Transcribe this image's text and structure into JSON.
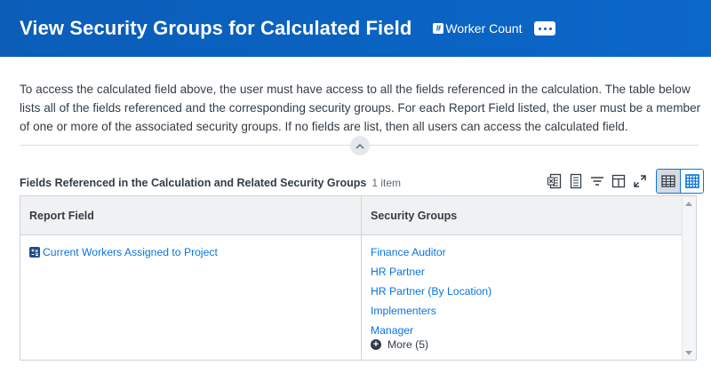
{
  "header": {
    "title": "View Security Groups for Calculated Field",
    "field_chip_icon": "#",
    "field_chip_label": "Worker Count",
    "related_actions_icon": "ellipsis-icon",
    "background_color": "#0b5db8"
  },
  "description": "To access the calculated field above, the user must have access to all the fields referenced in the calculation.  The table below lists all of the fields referenced and the corresponding security groups. For each Report Field listed, the user must be a member of one or more of the associated security groups.  If no fields are list, then all users can access the calculated field.",
  "grid": {
    "title": "Fields Referenced in the Calculation and Related Security Groups",
    "count": "1 item",
    "toolbar": [
      "export-to-excel-icon",
      "export-to-pdf-icon",
      "filter-icon",
      "column-config-icon",
      "fullscreen-icon"
    ],
    "view_toggle": [
      "table-view-icon",
      "grid-view-icon"
    ],
    "columns": [
      "Report Field",
      "Security Groups"
    ],
    "rows": [
      {
        "report_field": "Current Workers Assigned to Project",
        "security_groups": [
          "Finance Auditor",
          "HR Partner",
          "HR Partner (By Location)",
          "Implementers",
          "Manager"
        ],
        "more_label": "More (5)"
      }
    ]
  },
  "colors": {
    "link": "#0875e1",
    "text": "#333d47",
    "header_bg": "#0b5db8"
  }
}
